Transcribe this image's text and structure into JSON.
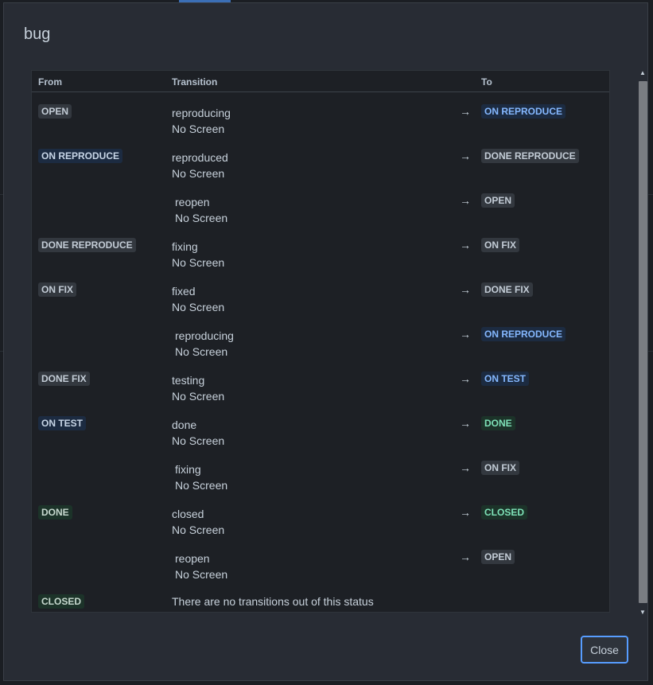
{
  "dialog": {
    "title": "bug",
    "close_label": "Close"
  },
  "table": {
    "headers": {
      "from": "From",
      "transition": "Transition",
      "to": "To"
    },
    "arrow": "→",
    "rows": [
      {
        "from": "OPEN",
        "from_color": "grey",
        "transition": "reproducing",
        "screen": "No Screen",
        "to": "ON REPRODUCE",
        "to_color": "blue"
      },
      {
        "from": "ON REPRODUCE",
        "from_color": "blue",
        "transition": "reproduced",
        "screen": "No Screen",
        "to": "DONE REPRODUCE",
        "to_color": "grey"
      },
      {
        "from": "",
        "from_color": "",
        "transition": "reopen",
        "screen": "No Screen",
        "to": "OPEN",
        "to_color": "grey"
      },
      {
        "from": "DONE REPRODUCE",
        "from_color": "grey",
        "transition": "fixing",
        "screen": "No Screen",
        "to": "ON FIX",
        "to_color": "grey"
      },
      {
        "from": "ON FIX",
        "from_color": "grey",
        "transition": "fixed",
        "screen": "No Screen",
        "to": "DONE FIX",
        "to_color": "grey"
      },
      {
        "from": "",
        "from_color": "",
        "transition": "reproducing",
        "screen": "No Screen",
        "to": "ON REPRODUCE",
        "to_color": "blue"
      },
      {
        "from": "DONE FIX",
        "from_color": "grey",
        "transition": "testing",
        "screen": "No Screen",
        "to": "ON TEST",
        "to_color": "blue"
      },
      {
        "from": "ON TEST",
        "from_color": "blue",
        "transition": "done",
        "screen": "No Screen",
        "to": "DONE",
        "to_color": "green"
      },
      {
        "from": "",
        "from_color": "",
        "transition": "fixing",
        "screen": "No Screen",
        "to": "ON FIX",
        "to_color": "grey"
      },
      {
        "from": "DONE",
        "from_color": "green",
        "transition": "closed",
        "screen": "No Screen",
        "to": "CLOSED",
        "to_color": "green"
      },
      {
        "from": "",
        "from_color": "",
        "transition": "reopen",
        "screen": "No Screen",
        "to": "OPEN",
        "to_color": "grey"
      }
    ],
    "final_row": {
      "from": "CLOSED",
      "from_color": "green",
      "message": "There are no transitions out of this status"
    }
  },
  "scrollbar": {
    "up_icon": "scroll-up-arrow",
    "down_icon": "scroll-down-arrow"
  },
  "colors": {
    "accent": "#579dff",
    "status_grey": "#33383f",
    "status_blue": "#85b8ff",
    "status_green": "#7ee2b8"
  }
}
